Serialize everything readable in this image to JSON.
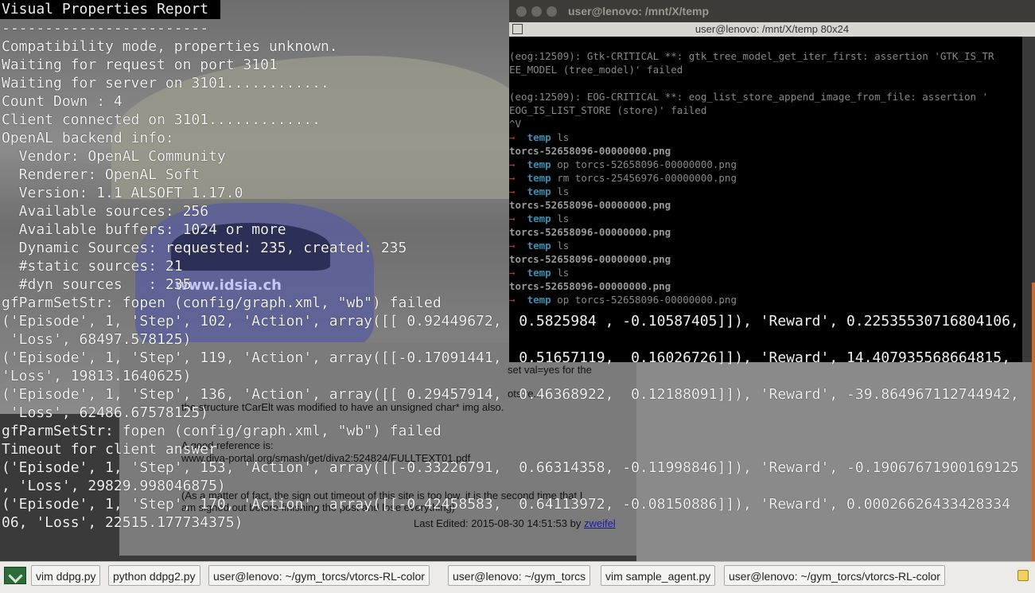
{
  "console": {
    "title": "Visual Properties Report",
    "lines": [
      "------------------------",
      "Compatibility mode, properties unknown.",
      "Waiting for request on port 3101",
      "Waiting for server on 3101............",
      "Count Down : 4",
      "Client connected on 3101.............",
      "OpenAL backend info:",
      "  Vendor: OpenAL Community",
      "  Renderer: OpenAL Soft",
      "  Version: 1.1 ALSOFT 1.17.0",
      "  Available sources: 256",
      "  Available buffers: 1024 or more",
      "  Dynamic Sources: requested: 235, created: 235",
      "  #static sources: 21",
      "  #dyn sources   : 235",
      "gfParmSetStr: fopen (config/graph.xml, \"wb\") failed",
      "('Episode', 1, 'Step', 102, 'Action', array([[ 0.92449672,  0.5825984 , -0.10587405]]), 'Reward', 0.22535530716804106,",
      " 'Loss', 68497.578125)",
      "('Episode', 1, 'Step', 119, 'Action', array([[-0.17091441,  0.51657119,  0.16026726]]), 'Reward', 14.407935568664815,",
      "'Loss', 19813.1640625)",
      "('Episode', 1, 'Step', 136, 'Action', array([[ 0.29457914,  0.46368922,  0.12188091]]), 'Reward', -39.864967112744942,",
      " 'Loss', 62486.67578125)",
      "gfParmSetStr: fopen (config/graph.xml, \"wb\") failed",
      "Timeout for client answer",
      "('Episode', 1, 'Step', 153, 'Action', array([[-0.33226791,  0.66314358, -0.11998846]]), 'Reward', -0.19067671900169125",
      ", 'Loss', 29829.998046875)",
      "('Episode', 1, 'Step', 170, 'Action', array([[-0.42458583,  0.64113972, -0.08150886]]), 'Reward', 0.00026626433428334",
      "06, 'Loss', 22515.177734375)"
    ]
  },
  "game": {
    "brand_text": "www.idsia.ch"
  },
  "terminal": {
    "window_title": "user@lenovo: /mnt/X/temp",
    "tab_title": "user@lenovo: /mnt/X/temp 80x24",
    "error_lines": [
      "(eog:12509): Gtk-CRITICAL **: gtk_tree_model_get_iter_first: assertion 'GTK_IS_TR",
      "EE_MODEL (tree_model)' failed",
      "",
      "(eog:12509): EOG-CRITICAL **: eog_list_store_append_image_from_file: assertion '",
      "EOG_IS_LIST_STORE (store)' failed",
      "^V"
    ],
    "prompt_symbol": "→",
    "cwd": "temp",
    "history": [
      {
        "cmd": "ls"
      },
      {
        "out": "torcs-52658096-00000000.png"
      },
      {
        "cmd": "op torcs-52658096-00000000.png"
      },
      {
        "cmd": "rm torcs-25456976-00000000.png"
      },
      {
        "cmd": "ls"
      },
      {
        "out": "torcs-52658096-00000000.png"
      },
      {
        "cmd": "ls"
      },
      {
        "out": "torcs-52658096-00000000.png"
      },
      {
        "cmd": "ls"
      },
      {
        "out": "torcs-52658096-00000000.png"
      },
      {
        "cmd": "ls"
      },
      {
        "out": "torcs-52658096-00000000.png"
      },
      {
        "cmd": "op torcs-52658096-00000000.png"
      }
    ]
  },
  "document": {
    "lines": [
      "set val=yes for the",
      "ots re...",
      "the structure tCarElt was modified to have an unsigned char* img also.",
      "A good reference is:",
      "www.diva-portal.org/smash/get/diva2:524824/FULLTEXT01.pdf",
      "(As a matter of fact, the sign out timeout of this site is too low, it is the second time that I",
      "am signed out before finishing the post and lose everything)"
    ],
    "last_edited_prefix": "Last Edited: 2015-08-30 14:51:53 by",
    "last_edited_user": "zweifel"
  },
  "taskbar": {
    "items": [
      "vim ddpg.py",
      "python ddpg2.py",
      "user@lenovo: ~/gym_torcs/vtorcs-RL-color",
      "user@lenovo: ~/gym_torcs",
      "vim sample_agent.py",
      "user@lenovo: ~/gym_torcs/vtorcs-RL-color"
    ]
  }
}
